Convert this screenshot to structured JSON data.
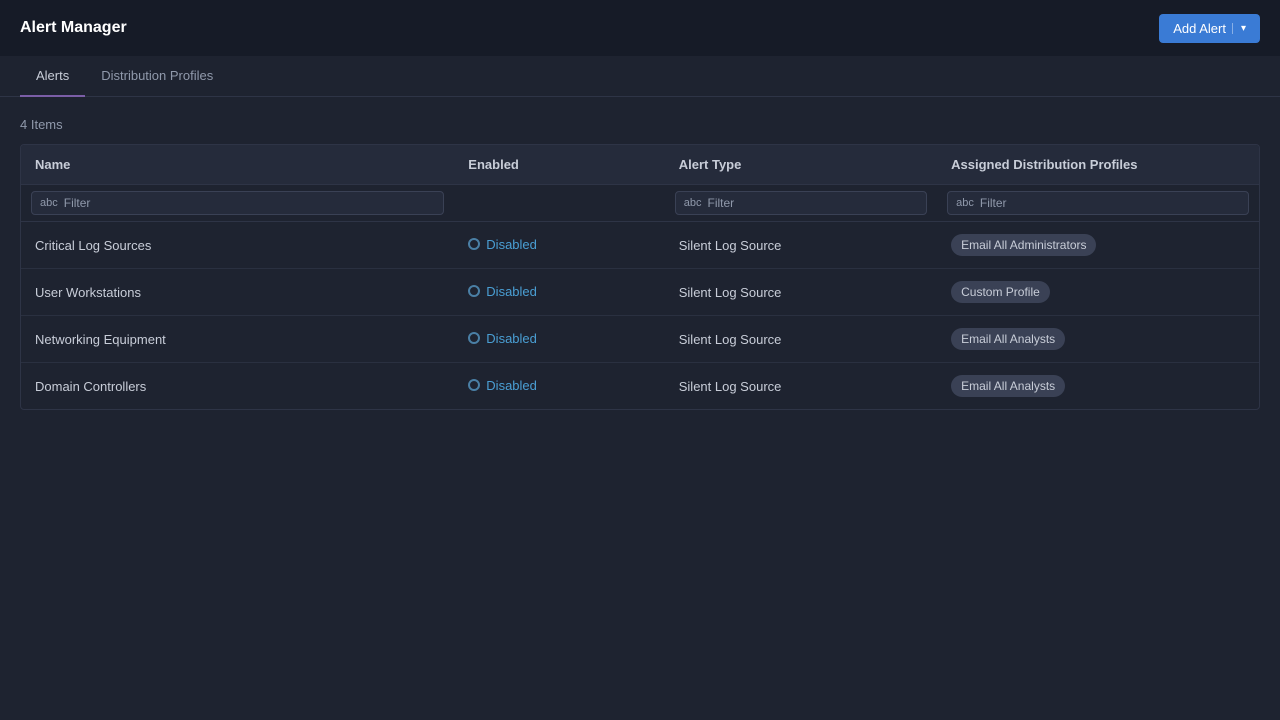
{
  "app": {
    "title": "Alert Manager"
  },
  "header": {
    "add_button_label": "Add Alert",
    "dropdown_arrow": "▾"
  },
  "tabs": [
    {
      "id": "alerts",
      "label": "Alerts",
      "active": true
    },
    {
      "id": "distribution-profiles",
      "label": "Distribution Profiles",
      "active": false
    }
  ],
  "table": {
    "items_count_label": "4 Items",
    "columns": [
      {
        "id": "name",
        "label": "Name"
      },
      {
        "id": "enabled",
        "label": "Enabled"
      },
      {
        "id": "alert_type",
        "label": "Alert Type"
      },
      {
        "id": "assigned_profiles",
        "label": "Assigned Distribution Profiles"
      }
    ],
    "filter_placeholders": {
      "name": "Filter",
      "alert_type": "Filter",
      "profiles": "Filter"
    },
    "rows": [
      {
        "name": "Critical Log Sources",
        "enabled_label": "Disabled",
        "alert_type": "Silent Log Source",
        "profile_tag": "Email All Administrators"
      },
      {
        "name": "User Workstations",
        "enabled_label": "Disabled",
        "alert_type": "Silent Log Source",
        "profile_tag": "Custom Profile"
      },
      {
        "name": "Networking Equipment",
        "enabled_label": "Disabled",
        "alert_type": "Silent Log Source",
        "profile_tag": "Email All Analysts"
      },
      {
        "name": "Domain Controllers",
        "enabled_label": "Disabled",
        "alert_type": "Silent Log Source",
        "profile_tag": "Email All Analysts"
      }
    ]
  }
}
